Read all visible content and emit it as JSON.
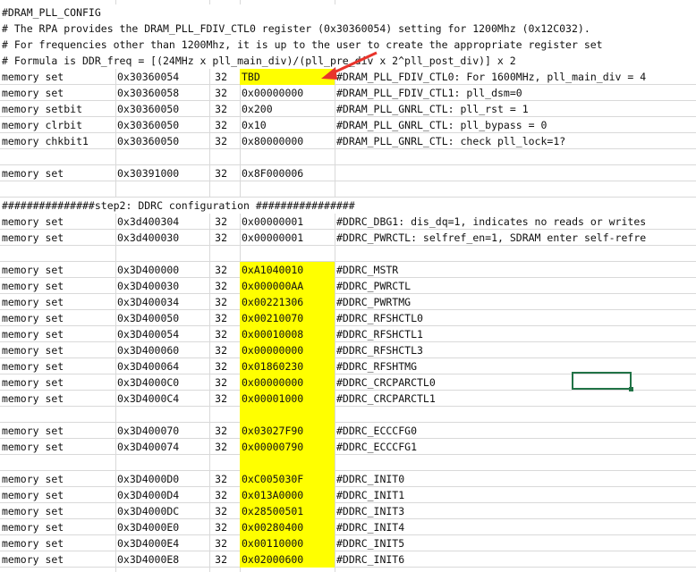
{
  "rows": [
    {
      "c0": "#DRAM_PLL_CONFIG",
      "full": true
    },
    {
      "c0": "# The RPA provides the DRAM_PLL_FDIV_CTL0 register (0x30360054) setting for 1200Mhz (0x12C032).",
      "full": true
    },
    {
      "c0": "# For frequencies other than 1200Mhz, it is up to the user to create the appropriate register set",
      "full": true
    },
    {
      "c0": "# Formula is DDR_freq = [(24MHz x pll_main_div)/(pll_pre_div x 2^pll_post_div)] x 2",
      "full": true
    },
    {
      "c0": "memory set",
      "c1": "0x30360054",
      "c2": "32",
      "c3": "TBD",
      "c4": "#DRAM_PLL_FDIV_CTL0: For 1600MHz, pll_main_div = 4",
      "yellow": true
    },
    {
      "c0": "memory set",
      "c1": "0x30360058",
      "c2": "32",
      "c3": "0x00000000",
      "c4": "#DRAM_PLL_FDIV_CTL1: pll_dsm=0"
    },
    {
      "c0": "memory setbit",
      "c1": "0x30360050",
      "c2": "32",
      "c3": "0x200",
      "c4": "#DRAM_PLL_GNRL_CTL: pll_rst = 1"
    },
    {
      "c0": "memory clrbit",
      "c1": "0x30360050",
      "c2": "32",
      "c3": "0x10",
      "c4": "#DRAM_PLL_GNRL_CTL: pll_bypass = 0"
    },
    {
      "c0": "memory chkbit1",
      "c1": "0x30360050",
      "c2": "32",
      "c3": "0x80000000",
      "c4": "#DRAM_PLL_GNRL_CTL: check pll_lock=1?"
    },
    {},
    {
      "c0": "memory set",
      "c1": "0x30391000",
      "c2": "32",
      "c3": "0x8F000006",
      "c4": ""
    },
    {},
    {
      "c0": "###############step2: DDRC configuration ################",
      "full": true
    },
    {
      "c0": "memory set",
      "c1": "0x3d400304",
      "c2": "32",
      "c3": "0x00000001",
      "c4": "#DDRC_DBG1: dis_dq=1, indicates no reads or writes"
    },
    {
      "c0": "memory set",
      "c1": "0x3d400030",
      "c2": "32",
      "c3": "0x00000001",
      "c4": "#DDRC_PWRCTL: selfref_en=1, SDRAM enter self-refre"
    },
    {},
    {
      "c0": "memory set",
      "c1": "0x3D400000",
      "c2": "32",
      "c3": "0xA1040010",
      "c4": "#DDRC_MSTR",
      "yellow": true
    },
    {
      "c0": "memory set",
      "c1": "0x3D400030",
      "c2": "32",
      "c3": "0x000000AA",
      "c4": "#DDRC_PWRCTL",
      "yellow": true
    },
    {
      "c0": "memory set",
      "c1": "0x3D400034",
      "c2": "32",
      "c3": "0x00221306",
      "c4": "#DDRC_PWRTMG",
      "yellow": true
    },
    {
      "c0": "memory set",
      "c1": "0x3D400050",
      "c2": "32",
      "c3": "0x00210070",
      "c4": "#DDRC_RFSHCTL0",
      "yellow": true
    },
    {
      "c0": "memory set",
      "c1": "0x3D400054",
      "c2": "32",
      "c3": "0x00010008",
      "c4": "#DDRC_RFSHCTL1",
      "yellow": true
    },
    {
      "c0": "memory set",
      "c1": "0x3D400060",
      "c2": "32",
      "c3": "0x00000000",
      "c4": "#DDRC_RFSHCTL3",
      "yellow": true
    },
    {
      "c0": "memory set",
      "c1": "0x3D400064",
      "c2": "32",
      "c3": "0x01860230",
      "c4": "#DDRC_RFSHTMG",
      "yellow": true
    },
    {
      "c0": "memory set",
      "c1": "0x3D4000C0",
      "c2": "32",
      "c3": "0x00000000",
      "c4": "#DDRC_CRCPARCTL0",
      "yellow": true
    },
    {
      "c0": "memory set",
      "c1": "0x3D4000C4",
      "c2": "32",
      "c3": "0x00001000",
      "c4": "#DDRC_CRCPARCTL1",
      "yellow": true
    },
    {
      "yellowEmpty": true
    },
    {
      "c0": "memory set",
      "c1": "0x3D400070",
      "c2": "32",
      "c3": "0x03027F90",
      "c4": "#DDRC_ECCCFG0",
      "yellow": true
    },
    {
      "c0": "memory set",
      "c1": "0x3D400074",
      "c2": "32",
      "c3": "0x00000790",
      "c4": "#DDRC_ECCCFG1",
      "yellow": true
    },
    {
      "yellowEmpty": true
    },
    {
      "c0": "memory set",
      "c1": "0x3D4000D0",
      "c2": "32",
      "c3": "0xC005030F",
      "c4": "#DDRC_INIT0",
      "yellow": true
    },
    {
      "c0": "memory set",
      "c1": "0x3D4000D4",
      "c2": "32",
      "c3": "0x013A0000",
      "c4": "#DDRC_INIT1",
      "yellow": true
    },
    {
      "c0": "memory set",
      "c1": "0x3D4000DC",
      "c2": "32",
      "c3": "0x28500501",
      "c4": "#DDRC_INIT3",
      "yellow": true
    },
    {
      "c0": "memory set",
      "c1": "0x3D4000E0",
      "c2": "32",
      "c3": "0x00280400",
      "c4": "#DDRC_INIT4",
      "yellow": true
    },
    {
      "c0": "memory set",
      "c1": "0x3D4000E4",
      "c2": "32",
      "c3": "0x00110000",
      "c4": "#DDRC_INIT5",
      "yellow": true
    },
    {
      "c0": "memory set",
      "c1": "0x3D4000E8",
      "c2": "32",
      "c3": "0x02000600",
      "c4": "#DDRC_INIT6",
      "yellow": true
    }
  ],
  "colors": {
    "highlight": "#ffff00",
    "gridline": "#d9d9d9",
    "selection": "#217346",
    "arrow": "#e8332b"
  }
}
